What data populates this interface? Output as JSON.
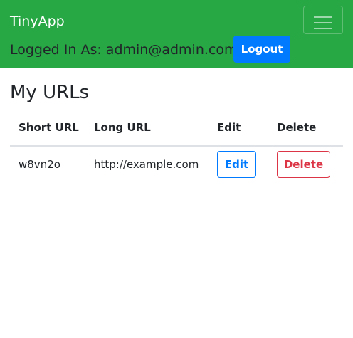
{
  "navbar": {
    "brand": "TinyApp",
    "logged_in_text": "Logged In As: admin@admin.com",
    "logout_label": "Logout",
    "toggler_icon": "hamburger-menu-icon",
    "background_color": "#28a745",
    "logout_color": "#007bff"
  },
  "main": {
    "title": "My URLs",
    "table": {
      "headers": [
        "Short URL",
        "Long URL",
        "Edit",
        "Delete"
      ],
      "rows": [
        {
          "short_url": "w8vn2o",
          "long_url": "http://example.com",
          "edit_label": "Edit",
          "delete_label": "Delete"
        }
      ]
    }
  }
}
